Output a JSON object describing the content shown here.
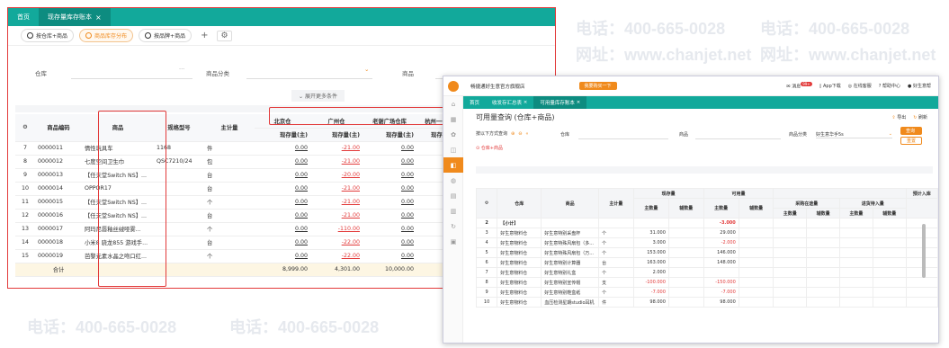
{
  "watermark": {
    "phone": "电话：400-665-0028",
    "site": "网址：www.chanjet.net"
  },
  "left": {
    "tabs": [
      {
        "label": "首页"
      },
      {
        "label": "现存量库存账本",
        "close": "×"
      }
    ],
    "subtabs": [
      {
        "label": "按仓库+商品"
      },
      {
        "label": "商品库存分布"
      },
      {
        "label": "按品牌+商品"
      }
    ],
    "add": "+",
    "filters": {
      "warehouse": "仓库",
      "dots": "···",
      "category": "商品分类",
      "product": "商品"
    },
    "expand": "展开更多条件",
    "headers": {
      "idx": "",
      "code": "商品编码",
      "name": "商品",
      "spec": "规格型号",
      "unit": "主计量",
      "w1": "北京仓",
      "w2": "广州仓",
      "w3": "老谢广场仓库",
      "w4": "杭州一号仓",
      "sub": "现存量(主)"
    },
    "rows": [
      {
        "i": "7",
        "code": "0000011",
        "name": "情性玩具车",
        "spec": "1168",
        "unit": "件",
        "b": "0.00",
        "g": "-21.00",
        "l": "0.00",
        "h": "0.00"
      },
      {
        "i": "8",
        "code": "0000012",
        "name": "七度空间卫生巾",
        "spec": "QSC7210/24",
        "unit": "包",
        "b": "0.00",
        "g": "-21.00",
        "l": "0.00",
        "h": "0.00"
      },
      {
        "i": "9",
        "code": "0000013",
        "name": "【任天堂Switch NS】...",
        "spec": "",
        "unit": "台",
        "b": "0.00",
        "g": "-20.00",
        "l": "0.00",
        "h": "0.00"
      },
      {
        "i": "10",
        "code": "0000014",
        "name": "OPPOR17",
        "spec": "",
        "unit": "台",
        "b": "0.00",
        "g": "-21.00",
        "l": "0.00",
        "h": "0.00"
      },
      {
        "i": "11",
        "code": "0000015",
        "name": "【任天堂Switch NS】...",
        "spec": "",
        "unit": "个",
        "b": "0.00",
        "g": "-21.00",
        "l": "0.00",
        "h": "0.00"
      },
      {
        "i": "12",
        "code": "0000016",
        "name": "【任天堂Switch NS】...",
        "spec": "",
        "unit": "台",
        "b": "0.00",
        "g": "-21.00",
        "l": "0.00",
        "h": "0.00"
      },
      {
        "i": "13",
        "code": "0000017",
        "name": "阿玛尼唇釉丝绒哑雾...",
        "spec": "",
        "unit": "个",
        "b": "0.00",
        "g": "-110.00",
        "l": "0.00",
        "h": "0.00"
      },
      {
        "i": "14",
        "code": "0000018",
        "name": "小米8 骁龙855 游戏手...",
        "spec": "",
        "unit": "台",
        "b": "0.00",
        "g": "-22.00",
        "l": "0.00",
        "h": "0.00"
      },
      {
        "i": "15",
        "code": "0000019",
        "name": "芭黎元素水晶之吻口红...",
        "spec": "",
        "unit": "个",
        "b": "0.00",
        "g": "-22.00",
        "l": "0.00",
        "h": "0.00"
      }
    ],
    "total": {
      "label": "合计",
      "b": "8,999.00",
      "g": "4,301.00",
      "l": "10,000.00",
      "h": "-4..."
    }
  },
  "right": {
    "company": "畅捷通好生意官方旗舰店",
    "trial": "我要购买一下",
    "msg_badge": "99+",
    "top_links": [
      "消息",
      "App下载",
      "在线客服",
      "帮助中心"
    ],
    "user": "好生意帮",
    "tabs": [
      {
        "label": "首页"
      },
      {
        "label": "收发存汇总表",
        "close": "×"
      },
      {
        "label": "可用量库存账本",
        "close": "×"
      }
    ],
    "title": "可用量查询 (仓库+商品)",
    "export": "导出",
    "refresh": "刷新",
    "filter": {
      "mode": "按以下方式查询",
      "warehouse": "仓库",
      "product": "商品",
      "category": "商品分类",
      "category_val": "好生意华手5s",
      "query": "查询",
      "reset": "重置"
    },
    "group_tag": "仓库+商品",
    "headers": {
      "ware": "仓库",
      "prod": "商品",
      "unit": "主计量",
      "onhand": "现存量",
      "avail": "可用量",
      "main": "主数量",
      "aux": "辅数量",
      "purchase": "采购在途量",
      "inbound": "进货待入量",
      "expected": "预计入库"
    },
    "rows": [
      {
        "i": "2",
        "w": "【小计】",
        "p": "",
        "u": "",
        "m": "",
        "am": "-3.000",
        "bold": true
      },
      {
        "i": "3",
        "w": "好生意物料仓",
        "p": "好生意特别采盘杯",
        "u": "个",
        "m": "31.000",
        "am": "29.000"
      },
      {
        "i": "4",
        "w": "好生意物料仓",
        "p": "好生意特殊风扇包（多...",
        "u": "个",
        "m": "3.000",
        "am": "-2.000"
      },
      {
        "i": "5",
        "w": "好生意物料仓",
        "p": "好生意特殊风扇包（万...",
        "u": "个",
        "m": "153.000",
        "am": "146.000"
      },
      {
        "i": "6",
        "w": "好生意物料仓",
        "p": "好生意特别计算器",
        "u": "台",
        "m": "163.000",
        "am": "148.000"
      },
      {
        "i": "7",
        "w": "好生意物料仓",
        "p": "好生意特别礼盒",
        "u": "个",
        "m": "2.000",
        "am": ""
      },
      {
        "i": "8",
        "w": "好生意物料仓",
        "p": "好生意特别宣传帽",
        "u": "支",
        "m": "-100.000",
        "am": "-150.000"
      },
      {
        "i": "9",
        "w": "好生意物料仓",
        "p": "好生意特别鞋盒纸",
        "u": "个",
        "m": "-7.000",
        "am": "-7.000"
      },
      {
        "i": "10",
        "w": "好生意物料仓",
        "p": "血压检测星期studio耳机",
        "u": "件",
        "m": "98.000",
        "am": "98.000"
      }
    ]
  }
}
